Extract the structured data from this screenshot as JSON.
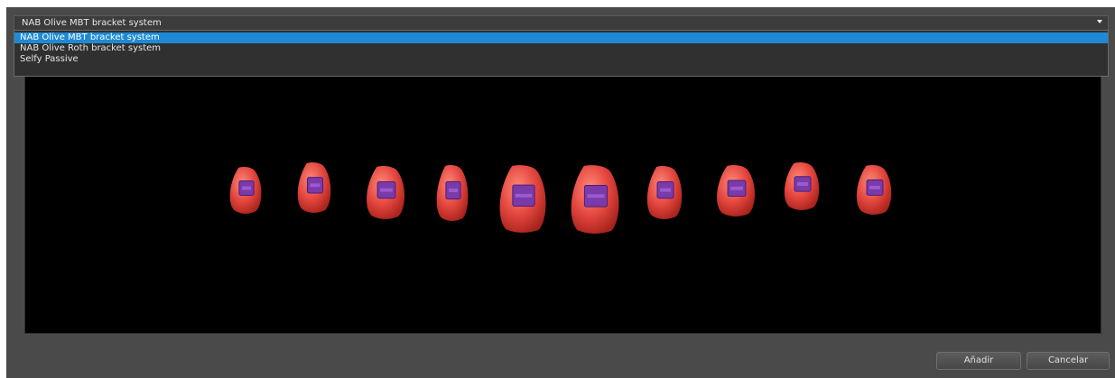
{
  "bracket_system": {
    "selected_value": "NAB Olive MBT bracket system",
    "options": [
      "NAB Olive MBT bracket system",
      "NAB Olive Roth bracket system",
      "Selfy Passive"
    ],
    "highlight_color": "#1e8ad6"
  },
  "viewport": {
    "background_color": "#000000",
    "tooth_color": "#e4473f",
    "bracket_color": "#7a3aa8",
    "tooth_count": 10
  },
  "buttons": {
    "add_label": "Añadir",
    "cancel_label": "Cancelar"
  }
}
